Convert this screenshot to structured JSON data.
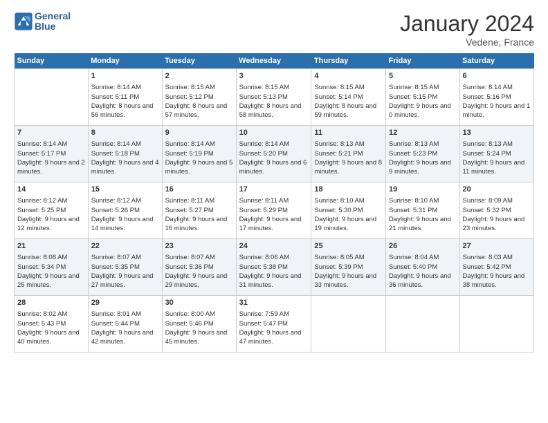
{
  "header": {
    "logo_line1": "General",
    "logo_line2": "Blue",
    "month": "January 2024",
    "location": "Vedene, France"
  },
  "weekdays": [
    "Sunday",
    "Monday",
    "Tuesday",
    "Wednesday",
    "Thursday",
    "Friday",
    "Saturday"
  ],
  "weeks": [
    [
      {
        "day": "",
        "empty": true
      },
      {
        "day": "1",
        "sunrise": "Sunrise: 8:14 AM",
        "sunset": "Sunset: 5:11 PM",
        "daylight": "Daylight: 8 hours and 56 minutes."
      },
      {
        "day": "2",
        "sunrise": "Sunrise: 8:15 AM",
        "sunset": "Sunset: 5:12 PM",
        "daylight": "Daylight: 8 hours and 57 minutes."
      },
      {
        "day": "3",
        "sunrise": "Sunrise: 8:15 AM",
        "sunset": "Sunset: 5:13 PM",
        "daylight": "Daylight: 8 hours and 58 minutes."
      },
      {
        "day": "4",
        "sunrise": "Sunrise: 8:15 AM",
        "sunset": "Sunset: 5:14 PM",
        "daylight": "Daylight: 8 hours and 59 minutes."
      },
      {
        "day": "5",
        "sunrise": "Sunrise: 8:15 AM",
        "sunset": "Sunset: 5:15 PM",
        "daylight": "Daylight: 9 hours and 0 minutes."
      },
      {
        "day": "6",
        "sunrise": "Sunrise: 8:14 AM",
        "sunset": "Sunset: 5:16 PM",
        "daylight": "Daylight: 9 hours and 1 minute."
      }
    ],
    [
      {
        "day": "7",
        "sunrise": "Sunrise: 8:14 AM",
        "sunset": "Sunset: 5:17 PM",
        "daylight": "Daylight: 9 hours and 2 minutes."
      },
      {
        "day": "8",
        "sunrise": "Sunrise: 8:14 AM",
        "sunset": "Sunset: 5:18 PM",
        "daylight": "Daylight: 9 hours and 4 minutes."
      },
      {
        "day": "9",
        "sunrise": "Sunrise: 8:14 AM",
        "sunset": "Sunset: 5:19 PM",
        "daylight": "Daylight: 9 hours and 5 minutes."
      },
      {
        "day": "10",
        "sunrise": "Sunrise: 8:14 AM",
        "sunset": "Sunset: 5:20 PM",
        "daylight": "Daylight: 9 hours and 6 minutes."
      },
      {
        "day": "11",
        "sunrise": "Sunrise: 8:13 AM",
        "sunset": "Sunset: 5:21 PM",
        "daylight": "Daylight: 9 hours and 8 minutes."
      },
      {
        "day": "12",
        "sunrise": "Sunrise: 8:13 AM",
        "sunset": "Sunset: 5:23 PM",
        "daylight": "Daylight: 9 hours and 9 minutes."
      },
      {
        "day": "13",
        "sunrise": "Sunrise: 8:13 AM",
        "sunset": "Sunset: 5:24 PM",
        "daylight": "Daylight: 9 hours and 11 minutes."
      }
    ],
    [
      {
        "day": "14",
        "sunrise": "Sunrise: 8:12 AM",
        "sunset": "Sunset: 5:25 PM",
        "daylight": "Daylight: 9 hours and 12 minutes."
      },
      {
        "day": "15",
        "sunrise": "Sunrise: 8:12 AM",
        "sunset": "Sunset: 5:26 PM",
        "daylight": "Daylight: 9 hours and 14 minutes."
      },
      {
        "day": "16",
        "sunrise": "Sunrise: 8:11 AM",
        "sunset": "Sunset: 5:27 PM",
        "daylight": "Daylight: 9 hours and 16 minutes."
      },
      {
        "day": "17",
        "sunrise": "Sunrise: 8:11 AM",
        "sunset": "Sunset: 5:29 PM",
        "daylight": "Daylight: 9 hours and 17 minutes."
      },
      {
        "day": "18",
        "sunrise": "Sunrise: 8:10 AM",
        "sunset": "Sunset: 5:30 PM",
        "daylight": "Daylight: 9 hours and 19 minutes."
      },
      {
        "day": "19",
        "sunrise": "Sunrise: 8:10 AM",
        "sunset": "Sunset: 5:31 PM",
        "daylight": "Daylight: 9 hours and 21 minutes."
      },
      {
        "day": "20",
        "sunrise": "Sunrise: 8:09 AM",
        "sunset": "Sunset: 5:32 PM",
        "daylight": "Daylight: 9 hours and 23 minutes."
      }
    ],
    [
      {
        "day": "21",
        "sunrise": "Sunrise: 8:08 AM",
        "sunset": "Sunset: 5:34 PM",
        "daylight": "Daylight: 9 hours and 25 minutes."
      },
      {
        "day": "22",
        "sunrise": "Sunrise: 8:07 AM",
        "sunset": "Sunset: 5:35 PM",
        "daylight": "Daylight: 9 hours and 27 minutes."
      },
      {
        "day": "23",
        "sunrise": "Sunrise: 8:07 AM",
        "sunset": "Sunset: 5:36 PM",
        "daylight": "Daylight: 9 hours and 29 minutes."
      },
      {
        "day": "24",
        "sunrise": "Sunrise: 8:06 AM",
        "sunset": "Sunset: 5:38 PM",
        "daylight": "Daylight: 9 hours and 31 minutes."
      },
      {
        "day": "25",
        "sunrise": "Sunrise: 8:05 AM",
        "sunset": "Sunset: 5:39 PM",
        "daylight": "Daylight: 9 hours and 33 minutes."
      },
      {
        "day": "26",
        "sunrise": "Sunrise: 8:04 AM",
        "sunset": "Sunset: 5:40 PM",
        "daylight": "Daylight: 9 hours and 36 minutes."
      },
      {
        "day": "27",
        "sunrise": "Sunrise: 8:03 AM",
        "sunset": "Sunset: 5:42 PM",
        "daylight": "Daylight: 9 hours and 38 minutes."
      }
    ],
    [
      {
        "day": "28",
        "sunrise": "Sunrise: 8:02 AM",
        "sunset": "Sunset: 5:43 PM",
        "daylight": "Daylight: 9 hours and 40 minutes."
      },
      {
        "day": "29",
        "sunrise": "Sunrise: 8:01 AM",
        "sunset": "Sunset: 5:44 PM",
        "daylight": "Daylight: 9 hours and 42 minutes."
      },
      {
        "day": "30",
        "sunrise": "Sunrise: 8:00 AM",
        "sunset": "Sunset: 5:46 PM",
        "daylight": "Daylight: 9 hours and 45 minutes."
      },
      {
        "day": "31",
        "sunrise": "Sunrise: 7:59 AM",
        "sunset": "Sunset: 5:47 PM",
        "daylight": "Daylight: 9 hours and 47 minutes."
      },
      {
        "day": "",
        "empty": true
      },
      {
        "day": "",
        "empty": true
      },
      {
        "day": "",
        "empty": true
      }
    ]
  ]
}
